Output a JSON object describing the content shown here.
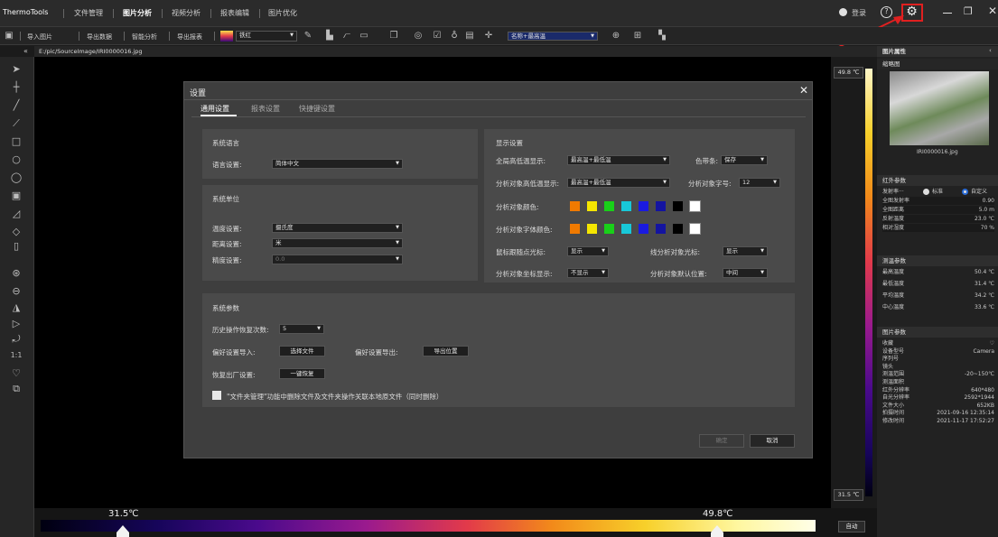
{
  "app": {
    "name": "ThermoTools"
  },
  "menu": {
    "items": [
      "文件管理",
      "图片分析",
      "视频分析",
      "报表编辑",
      "图片优化"
    ],
    "active": "图片分析"
  },
  "titlebar": {
    "login": "登录"
  },
  "toolbar": {
    "import": "导入图片",
    "export_data": "导出数据",
    "smart_analysis": "智能分析",
    "export_report": "导出报表",
    "palette": "铁红",
    "name_select": "名称+最高温"
  },
  "path": "E:/pic/SourceImage/IRI0000016.jpg",
  "scale": {
    "top_temp": "49.8 ℃",
    "bottom_temp": "31.5 ℃",
    "left_marker": "31.5℃",
    "right_marker": "49.8℃",
    "auto": "自动"
  },
  "modal": {
    "title": "设置",
    "tabs": [
      "通用设置",
      "报表设置",
      "快捷键设置"
    ],
    "language": {
      "heading": "系统语言",
      "label": "语言设置:",
      "value": "简体中文"
    },
    "units": {
      "heading": "系统单位",
      "temp_label": "温度设置:",
      "temp_value": "摄氏度",
      "dist_label": "距离设置:",
      "dist_value": "米",
      "prec_label": "精度设置:",
      "prec_value": "0.0"
    },
    "display": {
      "heading": "显示设置",
      "global_label": "全局高低温显示:",
      "global_value": "最高温+最低温",
      "colorbar_label": "色带条:",
      "colorbar_value": "保存",
      "obj_label": "分析对象高低温显示:",
      "obj_value": "最高温+最低温",
      "fontsize_label": "分析对象字号:",
      "fontsize_value": "12",
      "objcolor_label": "分析对象颜色:",
      "fontcolor_label": "分析对象字体颜色:",
      "cursor_label": "鼠标跟随点光标:",
      "cursor_value": "显示",
      "line_label": "线分析对象光标:",
      "line_value": "显示",
      "coord_label": "分析对象坐标显示:",
      "coord_value": "不显示",
      "pos_label": "分析对象默认位置:",
      "pos_value": "中间",
      "colors": [
        "#f07a00",
        "#f5e600",
        "#19d019",
        "#18c8d8",
        "#1a1ae0",
        "#1414a0",
        "#000000",
        "#ffffff"
      ]
    },
    "system": {
      "heading": "系统参数",
      "history_label": "历史操作恢复次数:",
      "history_value": "5",
      "import_label": "偏好设置导入:",
      "import_btn": "选择文件",
      "export_label": "偏好设置导出:",
      "export_btn": "导出位置",
      "reset_label": "恢复出厂设置:",
      "reset_btn": "一键恢复",
      "checkbox_label": "\"文件夹管理\"功能中删除文件及文件夹操作关联本地原文件（同时删除）"
    },
    "confirm": "确定",
    "cancel": "取消"
  },
  "props": {
    "title": "图片属性",
    "thumb_label": "缩略图",
    "filename": "IRI0000016.jpg",
    "ir_head": "红外参数",
    "emiss": "发射率···",
    "std": "标准",
    "custom": "自定义",
    "rows1": [
      [
        "全图发射率",
        "0.90"
      ],
      [
        "全图距离",
        "5.0 m"
      ],
      [
        "反射温度",
        "23.0 ℃"
      ],
      [
        "相对湿度",
        "70 %"
      ]
    ],
    "temp_head": "测温参数",
    "rows2": [
      [
        "最高温度",
        "50.4 ℃"
      ],
      [
        "最低温度",
        "31.4 ℃"
      ],
      [
        "平均温度",
        "34.2 ℃"
      ],
      [
        "中心温度",
        "33.6 ℃"
      ]
    ],
    "img_head": "图片参数",
    "rows3": [
      [
        "收藏",
        "♡"
      ],
      [
        "设备型号",
        "Camera"
      ],
      [
        "序列号",
        ""
      ],
      [
        "镜头",
        ""
      ],
      [
        "测温范围",
        "-20~150℃"
      ],
      [
        "测温面积",
        ""
      ],
      [
        "红外分辨率",
        "640*480"
      ],
      [
        "自光分辨率",
        "2592*1944"
      ],
      [
        "文件大小",
        "652KB"
      ],
      [
        "拍摄时间",
        "2021-09-16 12:35:14"
      ],
      [
        "修改时间",
        "2021-11-17 17:52:27"
      ]
    ]
  }
}
